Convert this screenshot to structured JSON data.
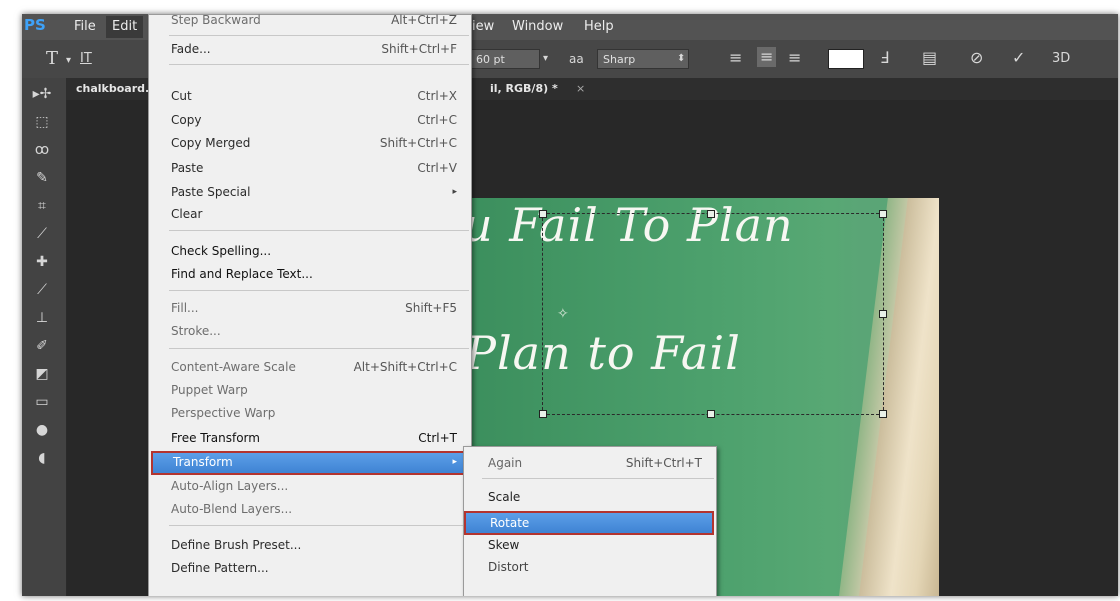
{
  "app": {
    "logo": "PS",
    "menubar": [
      "File",
      "Edit",
      "View",
      "Window",
      "Help"
    ],
    "menubar_partial": {
      "view": "iew"
    },
    "active_menu": "Edit"
  },
  "options_bar": {
    "type_tool": "T",
    "orientation_icon": "IT",
    "font_size": "60 pt",
    "aa_label": "aa",
    "antialias": "Sharp",
    "commit_icon": "✓",
    "threeD": "3D"
  },
  "document": {
    "tab_left": "chalkboard.",
    "tab_right": "il, RGB/8) *",
    "tab_close": "×"
  },
  "canvas": {
    "line1": "u Fail To Plan",
    "line2": "Plan to Fail"
  },
  "edit_menu": {
    "items": [
      {
        "label": "Step Backward",
        "shortcut": "Alt+Ctrl+Z"
      },
      {
        "label": "Fade...",
        "shortcut": "Shift+Ctrl+F"
      },
      {
        "label": "Cut",
        "shortcut": "Ctrl+X"
      },
      {
        "label": "Copy",
        "shortcut": "Ctrl+C"
      },
      {
        "label": "Copy Merged",
        "shortcut": "Shift+Ctrl+C"
      },
      {
        "label": "Paste",
        "shortcut": "Ctrl+V"
      },
      {
        "label": "Paste Special",
        "shortcut": "▸"
      },
      {
        "label": "Clear",
        "shortcut": ""
      },
      {
        "label": "Check Spelling...",
        "shortcut": ""
      },
      {
        "label": "Find and Replace Text...",
        "shortcut": ""
      },
      {
        "label": "Fill...",
        "shortcut": "Shift+F5"
      },
      {
        "label": "Stroke...",
        "shortcut": ""
      },
      {
        "label": "Content-Aware Scale",
        "shortcut": "Alt+Shift+Ctrl+C"
      },
      {
        "label": "Puppet Warp",
        "shortcut": ""
      },
      {
        "label": "Perspective Warp",
        "shortcut": ""
      },
      {
        "label": "Free Transform",
        "shortcut": "Ctrl+T"
      },
      {
        "label": "Transform",
        "shortcut": "▸"
      },
      {
        "label": "Auto-Align Layers...",
        "shortcut": ""
      },
      {
        "label": "Auto-Blend Layers...",
        "shortcut": ""
      },
      {
        "label": "Define Brush Preset...",
        "shortcut": ""
      },
      {
        "label": "Define Pattern...",
        "shortcut": ""
      }
    ]
  },
  "transform_submenu": {
    "items": [
      {
        "label": "Again",
        "shortcut": "Shift+Ctrl+T"
      },
      {
        "label": "Scale",
        "shortcut": ""
      },
      {
        "label": "Rotate",
        "shortcut": ""
      },
      {
        "label": "Skew",
        "shortcut": ""
      },
      {
        "label": "Distort",
        "shortcut": ""
      }
    ]
  }
}
